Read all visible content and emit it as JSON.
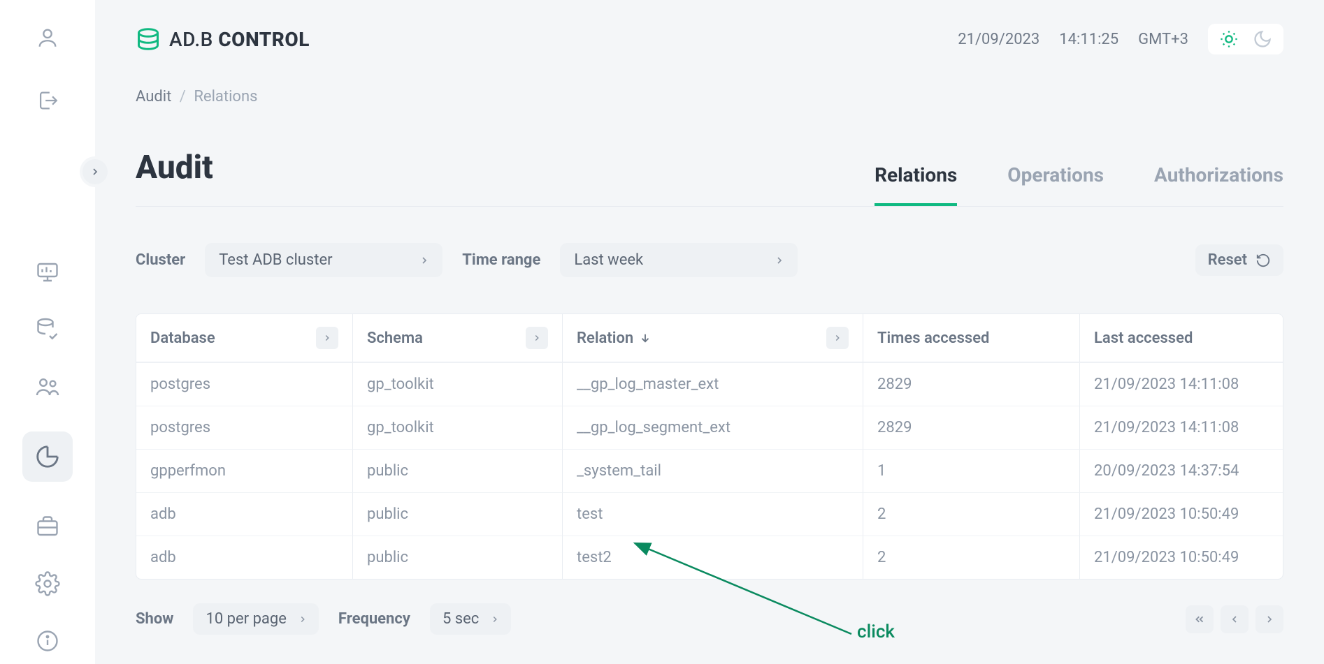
{
  "header": {
    "logo_text_prefix": "AD.B ",
    "logo_text_bold": "CONTROL",
    "date": "21/09/2023",
    "time": "14:11:25",
    "tz": "GMT+3"
  },
  "breadcrumb": {
    "root": "Audit",
    "current": "Relations"
  },
  "page": {
    "title": "Audit"
  },
  "tabs": [
    {
      "label": "Relations",
      "active": true
    },
    {
      "label": "Operations",
      "active": false
    },
    {
      "label": "Authorizations",
      "active": false
    }
  ],
  "filters": {
    "cluster_label": "Cluster",
    "cluster_value": "Test ADB cluster",
    "time_label": "Time range",
    "time_value": "Last week",
    "reset_label": "Reset"
  },
  "columns": {
    "database": "Database",
    "schema": "Schema",
    "relation": "Relation",
    "times": "Times accessed",
    "last": "Last accessed"
  },
  "rows": [
    {
      "database": "postgres",
      "schema": "gp_toolkit",
      "relation": "__gp_log_master_ext",
      "times": "2829",
      "last": "21/09/2023 14:11:08"
    },
    {
      "database": "postgres",
      "schema": "gp_toolkit",
      "relation": "__gp_log_segment_ext",
      "times": "2829",
      "last": "21/09/2023 14:11:08"
    },
    {
      "database": "gpperfmon",
      "schema": "public",
      "relation": "_system_tail",
      "times": "1",
      "last": "20/09/2023 14:37:54"
    },
    {
      "database": "adb",
      "schema": "public",
      "relation": "test",
      "times": "2",
      "last": "21/09/2023 10:50:49"
    },
    {
      "database": "adb",
      "schema": "public",
      "relation": "test2",
      "times": "2",
      "last": "21/09/2023 10:50:49"
    }
  ],
  "footer": {
    "show_label": "Show",
    "show_value": "10 per page",
    "freq_label": "Frequency",
    "freq_value": "5 sec"
  },
  "annotation": {
    "label": "click"
  }
}
